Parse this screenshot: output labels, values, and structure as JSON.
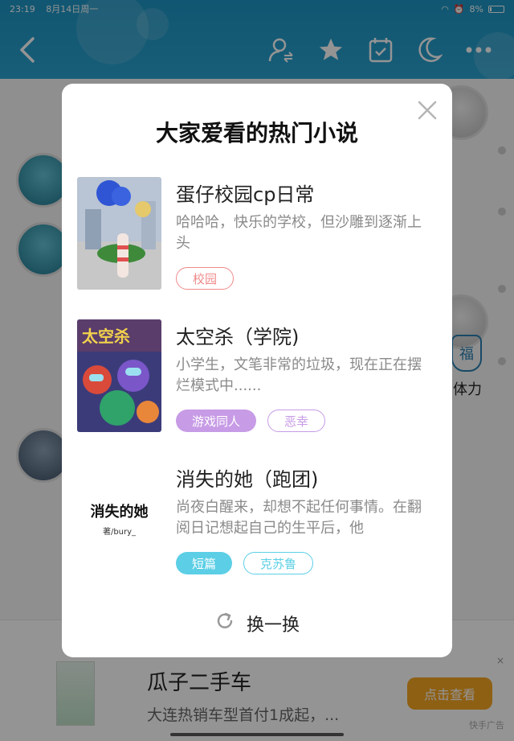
{
  "status": {
    "time": "23:19",
    "date": "8月14日周一",
    "battery": "8%"
  },
  "header": {
    "icons": [
      "back-icon",
      "user-switch-icon",
      "star-icon",
      "calendar-check-icon",
      "moon-icon",
      "more-icon"
    ]
  },
  "background": {
    "side_label": "体力",
    "side_badge": "福"
  },
  "modal": {
    "title": "大家爱看的热门小说",
    "books": [
      {
        "title": "蛋仔校园cp日常",
        "desc": "哈哈哈，快乐的学校，但沙雕到逐渐上头",
        "tags": [
          {
            "label": "校园",
            "color": "#f08a8a"
          }
        ]
      },
      {
        "title": "太空杀（学院)",
        "desc": "小学生，文笔非常的垃圾，现在正在摆烂模式中......",
        "tags": [
          {
            "label": "游戏同人",
            "color": "#c79be6",
            "filled": true
          },
          {
            "label": "恶幸",
            "color": "#c79be6"
          }
        ]
      },
      {
        "title": "消失的她（跑团)",
        "desc": "尚夜白醒来，却想不起任何事情。在翻阅日记想起自己的生平后，他",
        "cover_title": "消失的她",
        "cover_author": "著/bury_",
        "tags": [
          {
            "label": "短篇",
            "color": "#5ccfe6",
            "filled": true
          },
          {
            "label": "克苏鲁",
            "color": "#5ccfe6"
          }
        ]
      }
    ],
    "refresh_label": "换一换"
  },
  "ad": {
    "title": "瓜子二手车",
    "desc": "大连热销车型首付1成起，...",
    "button": "点击查看",
    "label": "快手广告",
    "close": "×"
  }
}
